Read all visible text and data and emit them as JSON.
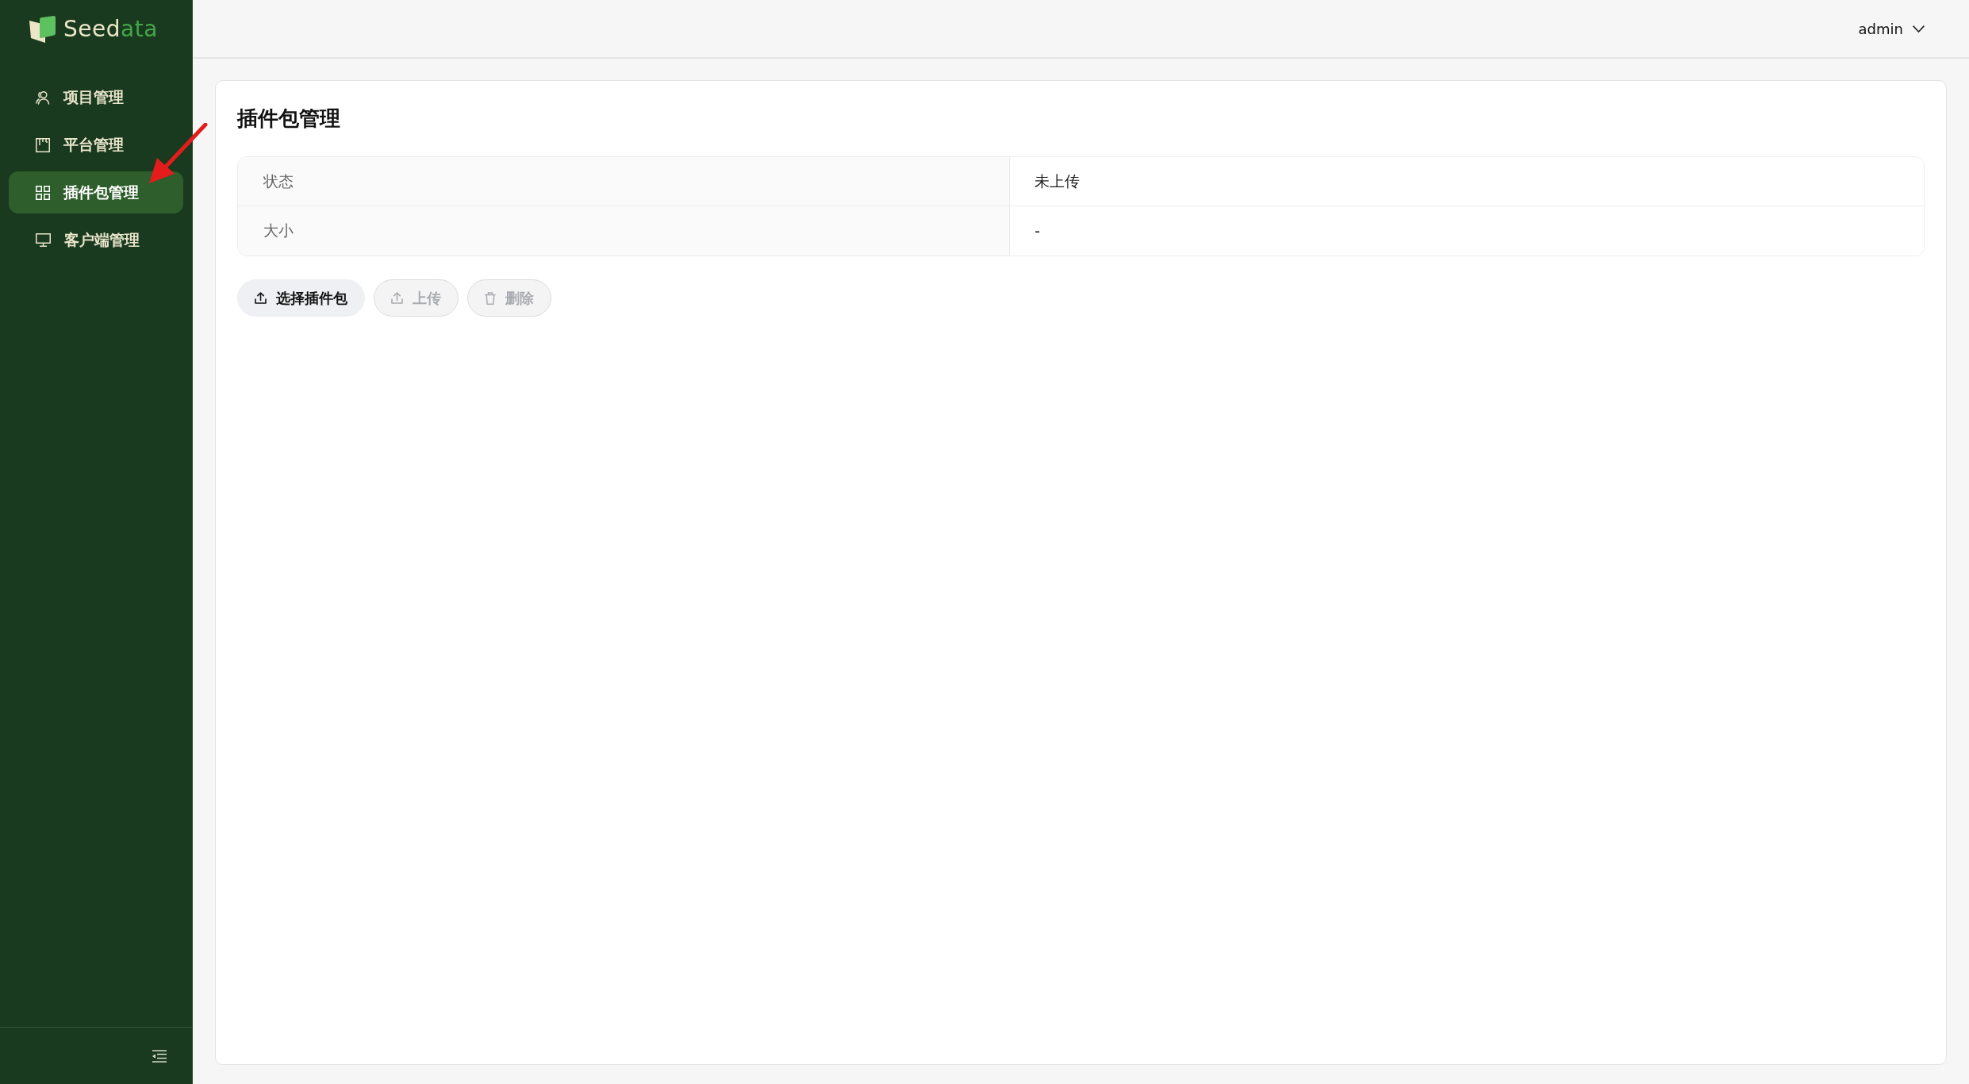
{
  "sidebar": {
    "logo": {
      "text_start": "Seed",
      "text_end": "ata"
    },
    "items": [
      {
        "label": "项目管理",
        "selected": false
      },
      {
        "label": "平台管理",
        "selected": false
      },
      {
        "label": "插件包管理",
        "selected": true
      },
      {
        "label": "客户端管理",
        "selected": false
      }
    ]
  },
  "header": {
    "user": "admin"
  },
  "page": {
    "title": "插件包管理",
    "details": [
      {
        "label": "状态",
        "value": "未上传"
      },
      {
        "label": "大小",
        "value": "-"
      }
    ],
    "actions": [
      {
        "label": "选择插件包",
        "kind": "upload",
        "disabled": false
      },
      {
        "label": "上传",
        "kind": "upload",
        "disabled": true
      },
      {
        "label": "删除",
        "kind": "delete",
        "disabled": true
      }
    ]
  }
}
